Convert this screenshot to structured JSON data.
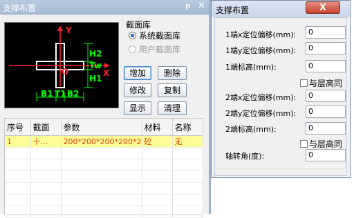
{
  "left_panel": {
    "title": "支撑布置",
    "pin_icon": "ᵽ",
    "close_icon": "✕",
    "library": {
      "label": "截面库",
      "options": [
        {
          "label": "系统截面库",
          "checked": true,
          "enabled": true
        },
        {
          "label": "用户截面库",
          "checked": false,
          "enabled": false
        }
      ]
    },
    "buttons": {
      "add": "增加",
      "delete": "删除",
      "modify": "修改",
      "copy": "复制",
      "show": "显示",
      "clear": "清理"
    },
    "preview": {
      "y_axis": "Y",
      "x_axis": "X",
      "origin": "O",
      "h2": "H2",
      "tw": "Tw",
      "h1": "H1",
      "b1": "B1",
      "t1": "T1",
      "b2": "B2",
      "colors": {
        "axis": "#ff2020",
        "dim": "#00ff00",
        "shape": "#ffffff"
      }
    },
    "table": {
      "columns": [
        "序号",
        "截面",
        "参数",
        "材料",
        "名称"
      ],
      "rows": [
        {
          "no": "1",
          "section": "十...",
          "params": "200*200*200*200*2...",
          "material": "砼",
          "name": "无"
        }
      ]
    }
  },
  "dialog": {
    "title": "支撑布置",
    "close_label": "X",
    "fields": {
      "end1_x": {
        "label": "1端x定位偏移(mm):",
        "value": "0"
      },
      "end1_y": {
        "label": "1端y定位偏移(mm):",
        "value": "0"
      },
      "end1_elev": {
        "label": "1端标高(mm):",
        "value": "0"
      },
      "end1_same": "与层高同",
      "end2_x": {
        "label": "2端x定位偏移(mm):",
        "value": "0"
      },
      "end2_y": {
        "label": "2端y定位偏移(mm):",
        "value": "0"
      },
      "end2_elev": {
        "label": "2端标高(mm):",
        "value": "0"
      },
      "end2_same": "与层高同",
      "rotation": {
        "label": "轴转角(度):",
        "value": "0"
      }
    }
  }
}
